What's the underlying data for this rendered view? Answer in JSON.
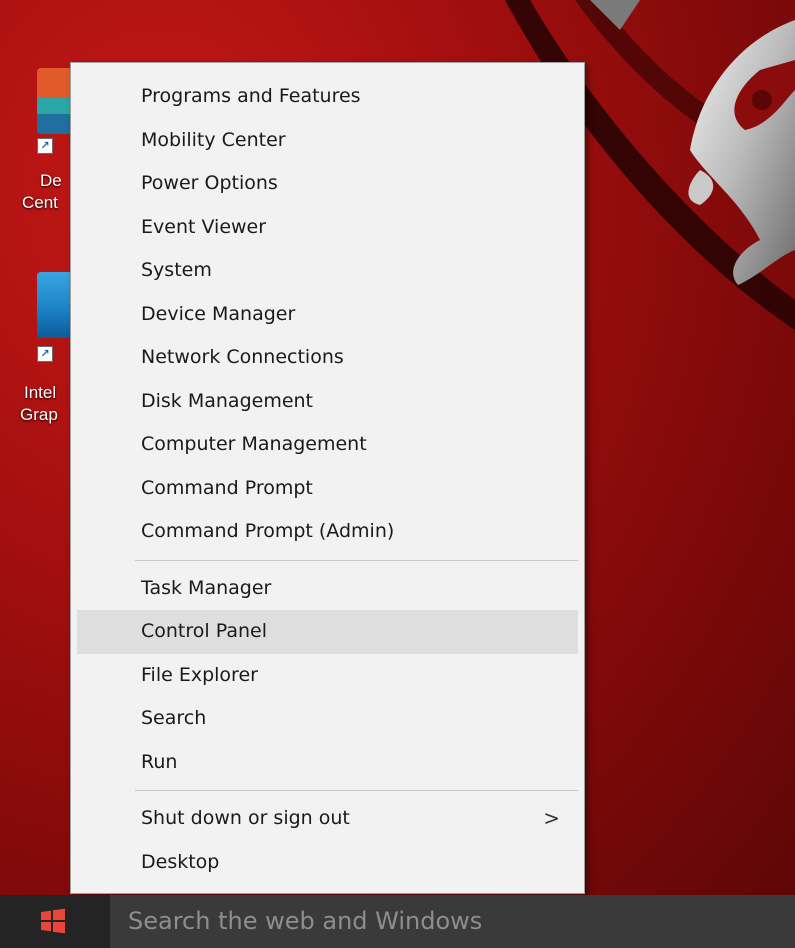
{
  "desktop": {
    "icons": [
      {
        "label_line1": "De",
        "label_line2": "Cent",
        "icon": "dell-center-icon"
      },
      {
        "label_line1": "Intel",
        "label_line2": "Grap",
        "icon": "intel-graphics-icon"
      }
    ]
  },
  "menu": {
    "group1": [
      "Programs and Features",
      "Mobility Center",
      "Power Options",
      "Event Viewer",
      "System",
      "Device Manager",
      "Network Connections",
      "Disk Management",
      "Computer Management",
      "Command Prompt",
      "Command Prompt (Admin)"
    ],
    "group2": [
      "Task Manager",
      "Control Panel",
      "File Explorer",
      "Search",
      "Run"
    ],
    "group3": [
      "Shut down or sign out",
      "Desktop"
    ],
    "submenu_arrow": ">",
    "highlighted_item": "Control Panel"
  },
  "taskbar": {
    "start_icon": "windows-logo-icon",
    "search_placeholder": "Search the web and Windows"
  },
  "colors": {
    "wallpaper": "#a50f0f",
    "menu_bg": "#f2f2f2",
    "menu_hover": "#dedede",
    "taskbar_bg": "#242424",
    "start_logo": "#e8463a"
  }
}
